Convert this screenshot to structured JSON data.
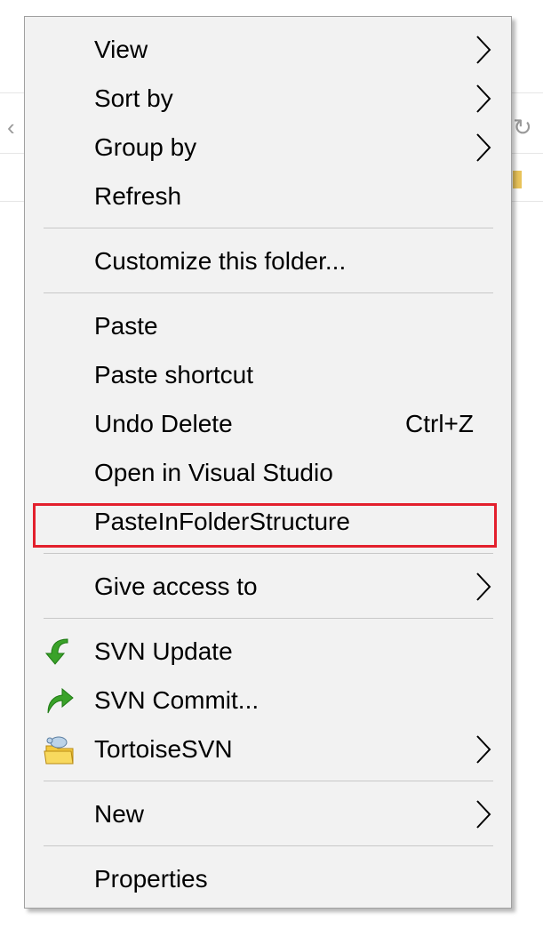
{
  "menu": {
    "items": [
      {
        "label": "View",
        "submenu": true
      },
      {
        "label": "Sort by",
        "submenu": true
      },
      {
        "label": "Group by",
        "submenu": true
      },
      {
        "label": "Refresh"
      },
      {
        "label": "Customize this folder..."
      },
      {
        "label": "Paste"
      },
      {
        "label": "Paste shortcut"
      },
      {
        "label": "Undo Delete",
        "shortcut": "Ctrl+Z"
      },
      {
        "label": "Open in Visual Studio"
      },
      {
        "label": "PasteInFolderStructure",
        "highlighted": true
      },
      {
        "label": "Give access to",
        "submenu": true
      },
      {
        "label": "SVN Update",
        "icon": "svn-update-icon"
      },
      {
        "label": "SVN Commit...",
        "icon": "svn-commit-icon"
      },
      {
        "label": "TortoiseSVN",
        "icon": "tortoisesvn-icon",
        "submenu": true
      },
      {
        "label": "New",
        "submenu": true
      },
      {
        "label": "Properties"
      }
    ]
  },
  "colors": {
    "menu_bg": "#f2f2f2",
    "separator": "#c8c8c8",
    "highlight_border": "#e3202d",
    "svn_green": "#3aa229"
  }
}
